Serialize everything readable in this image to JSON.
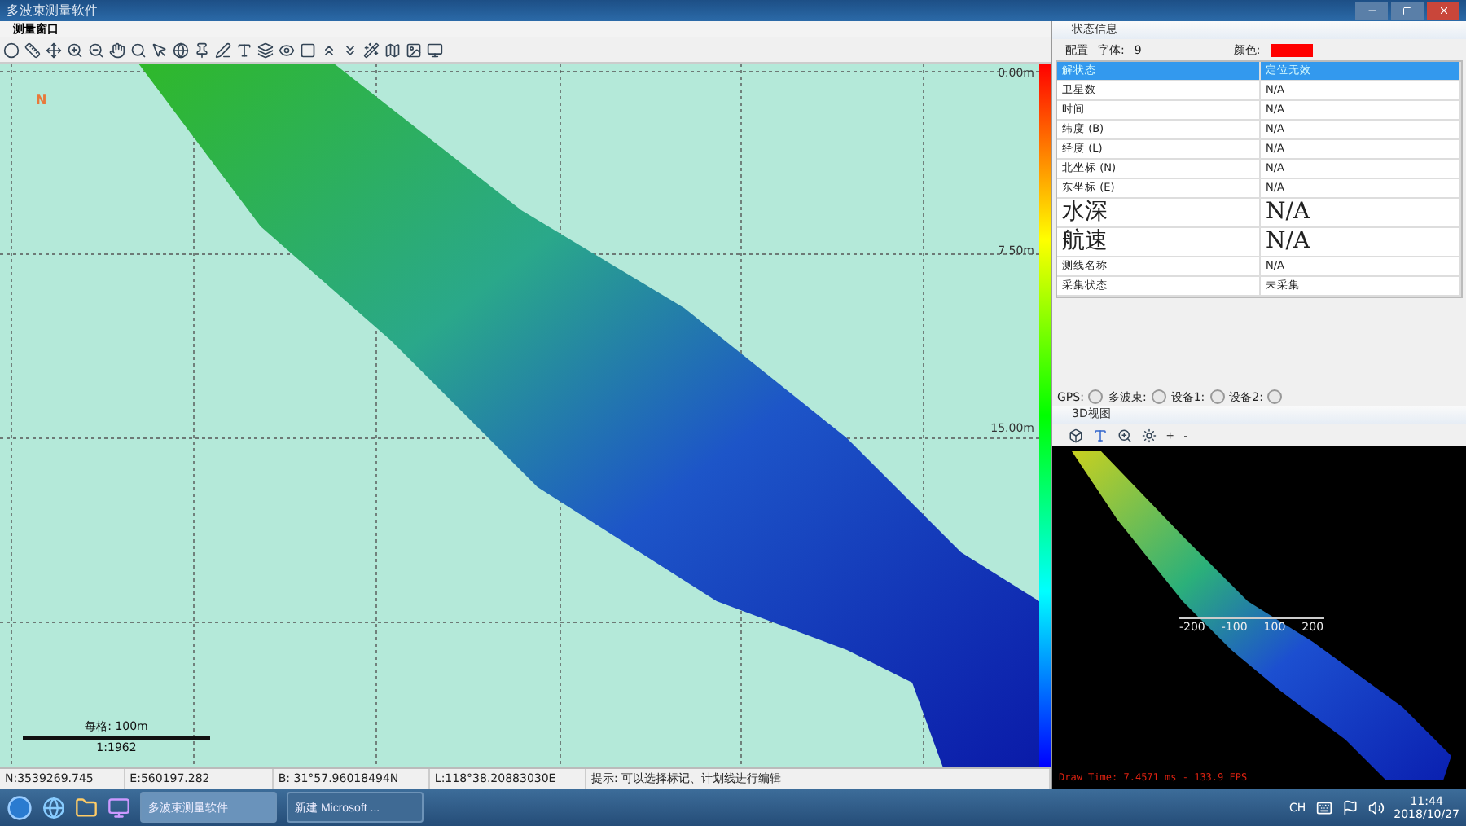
{
  "window": {
    "title": "多波束测量软件"
  },
  "map_window": {
    "title": "测量窗口",
    "north": "N",
    "depth_labels": [
      "0.00m",
      "7.50m",
      "15.00m"
    ],
    "scale": {
      "label": "每格: 100m",
      "ratio": "1:1962"
    }
  },
  "status_bar": [
    "N:3539269.745",
    "E:560197.282",
    "B: 31°57.96018494N",
    "L:118°38.20883030E",
    "提示: 可以选择标记、计划线进行编辑"
  ],
  "status_panel": {
    "title": "状态信息",
    "config": {
      "label": "配置",
      "font_label": "字体:",
      "font_value": "9",
      "color_label": "颜色:",
      "color": "#ff0000"
    },
    "rows": [
      {
        "name": "解状态",
        "value": "定位无效",
        "kind": "normal",
        "selected": true
      },
      {
        "name": "卫星数",
        "value": "N/A",
        "kind": "normal",
        "selected": false
      },
      {
        "name": "时间",
        "value": "N/A",
        "kind": "normal",
        "selected": false
      },
      {
        "name": "纬度 (B)",
        "value": "N/A",
        "kind": "normal",
        "selected": false
      },
      {
        "name": "经度 (L)",
        "value": "N/A",
        "kind": "normal",
        "selected": false
      },
      {
        "name": "北坐标 (N)",
        "value": "N/A",
        "kind": "normal",
        "selected": false
      },
      {
        "name": "东坐标 (E)",
        "value": "N/A",
        "kind": "normal",
        "selected": false
      },
      {
        "name": "水深",
        "value": "N/A",
        "kind": "big",
        "selected": false
      },
      {
        "name": "航速",
        "value": "N/A",
        "kind": "big",
        "selected": false
      },
      {
        "name": "测线名称",
        "value": "N/A",
        "kind": "normal",
        "selected": false
      },
      {
        "name": "采集状态",
        "value": "未采集",
        "kind": "normal",
        "selected": false
      }
    ]
  },
  "devices": [
    {
      "label": "GPS:",
      "on": false
    },
    {
      "label": "多波束:",
      "on": false
    },
    {
      "label": "设备1:",
      "on": false
    },
    {
      "label": "设备2:",
      "on": false
    }
  ],
  "view3d": {
    "title": "3D视图",
    "tools": [
      "+",
      "-"
    ],
    "axis_labels": [
      "-200",
      "-100",
      "100",
      "200"
    ],
    "draw_time": "Draw Time: 7.4571 ms - 133.9 FPS"
  },
  "taskbar": {
    "buttons": [
      {
        "label": "多波束测量软件",
        "selected": true
      },
      {
        "label": "新建 Microsoft ...",
        "selected": false
      }
    ],
    "lang": "CH",
    "time": "11:44",
    "date": "2018/10/27"
  }
}
